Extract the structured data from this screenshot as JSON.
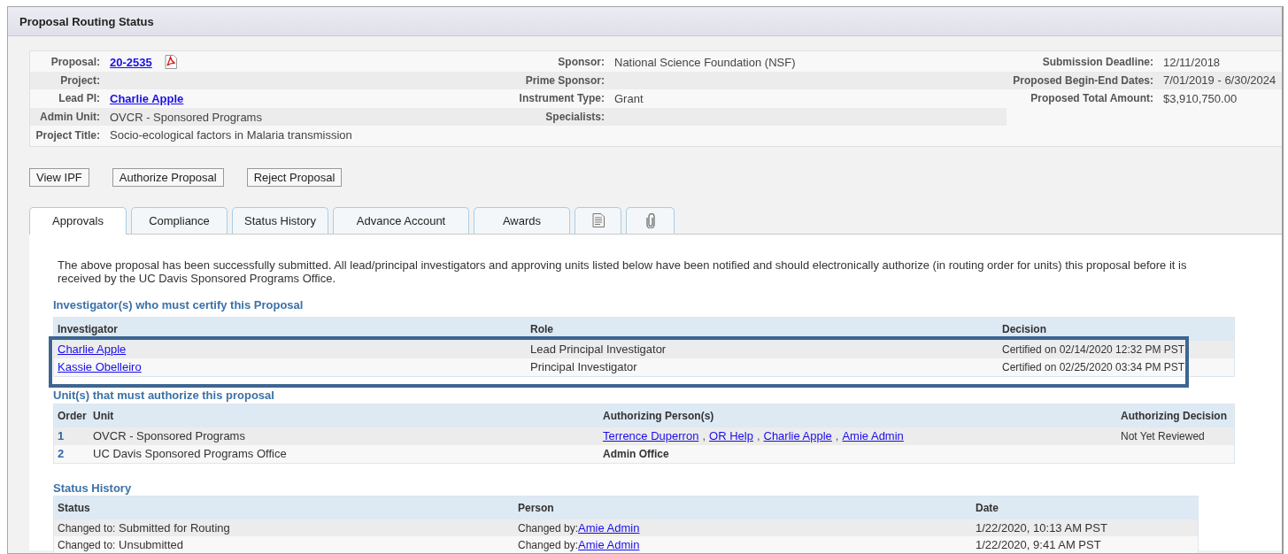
{
  "header": {
    "title": "Proposal Routing Status"
  },
  "info_left": [
    {
      "fields": [
        {
          "label": "Proposal:",
          "value": "20-2535",
          "kind": "pdf-link"
        },
        {
          "label": "Sponsor:",
          "value": "National Science Foundation (NSF)",
          "kind": "text"
        }
      ]
    },
    {
      "fields": [
        {
          "label": "Project:"
        },
        {
          "label": "Prime Sponsor:"
        }
      ]
    },
    {
      "fields": [
        {
          "label": "Lead PI:",
          "value": "Charlie Apple",
          "kind": "link"
        },
        {
          "label": "Instrument Type:",
          "value": "Grant",
          "kind": "text"
        }
      ]
    },
    {
      "fields": [
        {
          "label": "Admin Unit:",
          "value": "OVCR - Sponsored Programs",
          "kind": "text"
        },
        {
          "label": "Specialists:"
        }
      ]
    },
    {
      "fields": [
        {
          "label": "Project Title:",
          "value": "Socio-ecological factors in Malaria transmission",
          "kind": "text"
        }
      ]
    }
  ],
  "info_right": [
    {
      "label": "Submission Deadline:",
      "value": "12/11/2018"
    },
    {
      "label": "Proposed Begin-End Dates:",
      "value": "7/01/2019 - 6/30/2024"
    },
    {
      "label": "Proposed Total Amount:",
      "value": "$3,910,750.00"
    }
  ],
  "buttons": [
    "View IPF",
    "Authorize Proposal",
    "Reject Proposal"
  ],
  "tabs": [
    {
      "kind": "text",
      "label": "Approvals",
      "selected": true
    },
    {
      "kind": "text",
      "label": "Compliance",
      "selected": false
    },
    {
      "kind": "text",
      "label": "Status History",
      "selected": false
    },
    {
      "kind": "text",
      "label": "Advance Account",
      "selected": false
    },
    {
      "kind": "text",
      "label": "Awards",
      "selected": false
    },
    {
      "kind": "document",
      "selected": false
    },
    {
      "kind": "attachment",
      "selected": false
    }
  ],
  "message": "The above proposal has been successfully submitted. All lead/principal investigators and approving units listed below have been notified and should electronically authorize (in routing order for units) this proposal before it is received by the UC Davis Sponsored Programs Office.",
  "investigators": {
    "heading": "Investigator(s) who must certify this Proposal",
    "annotation_box": true,
    "columns": [
      "Investigator",
      "Role",
      "Decision"
    ],
    "rows": [
      {
        "investigator": "Charlie Apple",
        "role": "Lead Principal Investigator",
        "decision": "Certified on 02/14/2020 12:32 PM PST"
      },
      {
        "investigator": "Kassie Obelleiro",
        "role": "Principal Investigator",
        "decision": "Certified on 02/25/2020 03:34 PM PST"
      }
    ]
  },
  "units": {
    "heading": "Unit(s) that must authorize this proposal",
    "columns": [
      "Order",
      "Unit",
      "Authorizing Person(s)",
      "Authorizing Decision"
    ],
    "rows": [
      {
        "order": "1",
        "unit": "OVCR - Sponsored Programs",
        "persons": [
          {
            "kind": "link",
            "text": "Terrence Duperron"
          },
          {
            "kind": "sep",
            "text": ","
          },
          {
            "kind": "link",
            "text": "OR Help"
          },
          {
            "kind": "sep",
            "text": ","
          },
          {
            "kind": "link",
            "text": "Charlie Apple"
          },
          {
            "kind": "sep",
            "text": ","
          },
          {
            "kind": "link",
            "text": "Amie Admin"
          }
        ],
        "decision": "Not Yet Reviewed"
      },
      {
        "order": "2",
        "unit": "UC Davis Sponsored Programs Office",
        "persons": [
          {
            "kind": "bold",
            "text": "Admin Office"
          }
        ]
      }
    ]
  },
  "status_history": {
    "heading": "Status History",
    "columns": [
      "Status",
      "Person",
      "Date"
    ],
    "rows": [
      {
        "status_prefix": "Changed to:",
        "status": "Submitted for Routing",
        "person_prefix": "Changed by:",
        "person": "Amie Admin",
        "date": "1/22/2020, 10:13 AM PST"
      },
      {
        "status_prefix": "Changed to:",
        "status": "Unsubmitted",
        "person_prefix": "Changed by:",
        "person": "Amie Admin",
        "date": "1/22/2020, 9:41 AM PST"
      }
    ]
  }
}
